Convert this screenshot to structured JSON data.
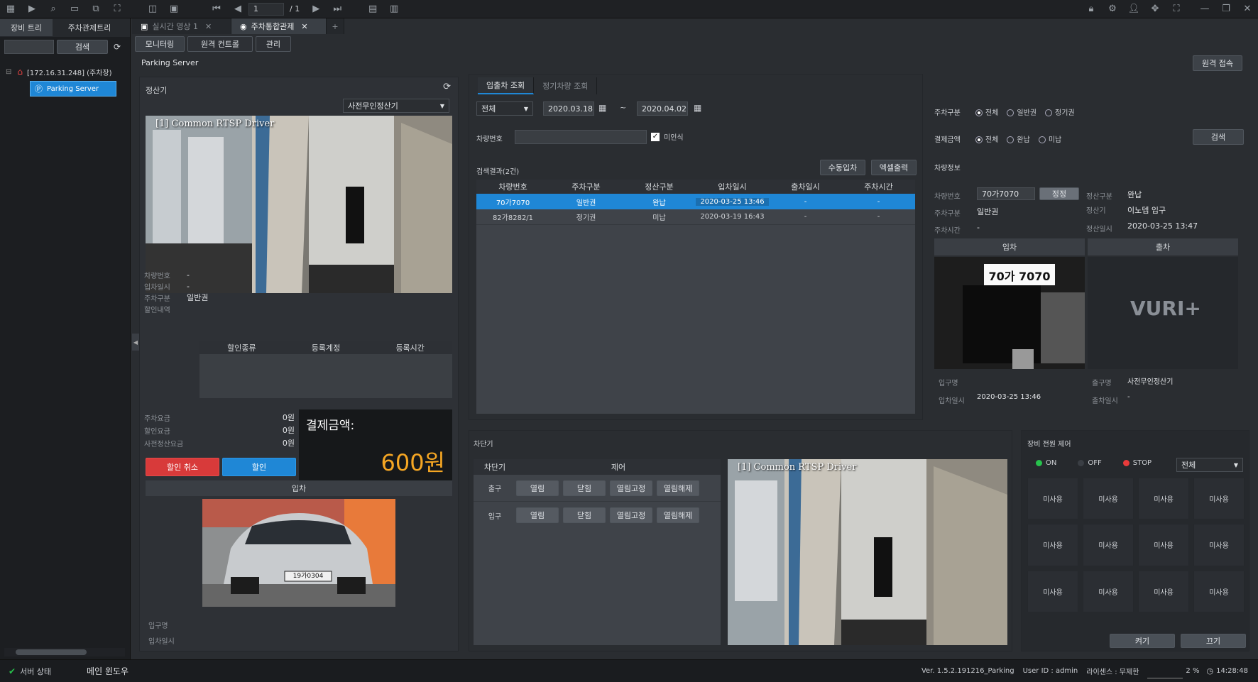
{
  "toolbar": {
    "page_current": "1",
    "page_total": "/ 1"
  },
  "left": {
    "tabs": [
      "장비 트리",
      "주차관제트리"
    ],
    "search_button": "검색",
    "tree_root": "[172.16.31.248] (주차장)",
    "tree_child": "Parking Server"
  },
  "doc_tabs": [
    {
      "label": "실시간 영상 1"
    },
    {
      "label": "주차통합관제"
    }
  ],
  "sub_tabs": [
    "모니터링",
    "원격 컨트롤",
    "관리"
  ],
  "server_label": "Parking Server",
  "remote_access_button": "원격 접속",
  "settlement": {
    "title": "정산기",
    "device_select": "사전무인정산기",
    "camera_overlay": "[1] Common RTSP Driver",
    "fields": {
      "car_number_label": "차량번호",
      "car_number_value": "-",
      "entry_time_label": "입차일시",
      "entry_time_value": "-",
      "parking_type_label": "주차구분",
      "parking_type_value": "일반권",
      "discount_label": "할인내역"
    },
    "discount_headers": [
      "할인종류",
      "등록계정",
      "등록시간"
    ],
    "fee_label": "주차요금",
    "fee_value": "0원",
    "discount_fee_label": "할인요금",
    "discount_fee_value": "0원",
    "prepaid_label": "사전정산요금",
    "prepaid_value": "0원",
    "pay_amount_label": "결제금액:",
    "pay_amount_value": "600원",
    "cancel_discount_button": "할인 취소",
    "discount_button": "할인",
    "entry_header": "입차",
    "plate_text": "19가0304",
    "entrance_label": "입구명",
    "entry_time2_label": "입차일시"
  },
  "search": {
    "tabs": [
      "입출차 조회",
      "정기차량 조회"
    ],
    "all_select": "전체",
    "date_from": "2020.03.18",
    "tilde": "~",
    "date_to": "2020.04.02",
    "car_number_label": "차량번호",
    "unrecognized_label": "미인식",
    "parking_type_label": "주차구분",
    "parking_type_options": [
      "전체",
      "일반권",
      "정기권"
    ],
    "payment_label": "결제금액",
    "payment_options": [
      "전체",
      "완납",
      "미납"
    ],
    "search_button": "검색",
    "result_title": "검색결과(2건)",
    "manual_entry_button": "수동입차",
    "excel_button": "엑셀출력",
    "columns": [
      "차량번호",
      "주차구분",
      "정산구분",
      "입차일시",
      "출차일시",
      "주차시간"
    ],
    "rows": [
      [
        "70가7070",
        "일반권",
        "완납",
        "2020-03-25 13:46",
        "-",
        "-"
      ],
      [
        "82가8282/1",
        "정기권",
        "미납",
        "2020-03-19 16:43",
        "-",
        "-"
      ]
    ]
  },
  "car_info": {
    "title": "차량정보",
    "car_number_label": "차량번호",
    "car_number_value": "70가7070",
    "edit_button": "정정",
    "settlement_type_label": "정산구분",
    "settlement_type_value": "완납",
    "parking_type_label": "주차구분",
    "parking_type_value": "일반권",
    "settler_label": "정산기",
    "settler_value": "이노뎁 입구",
    "parking_time_label": "주차시간",
    "parking_time_value": "-",
    "settle_time_label": "정산일시",
    "settle_time_value": "2020-03-25 13:47",
    "entry_header": "입차",
    "exit_header": "출차",
    "plate_text": "70가 7070",
    "logo_text": "VURI+",
    "entrance_label": "입구명",
    "entry_time_label": "입차일시",
    "entry_time_value": "2020-03-25 13:46",
    "exit_name_label": "출구명",
    "exit_name_value": "사전무인정산기",
    "exit_time_label": "출차일시",
    "exit_time_value": "-"
  },
  "barrier": {
    "title": "차단기",
    "col1": "차단기",
    "col2": "제어",
    "rows": [
      {
        "name": "출구",
        "buttons": [
          "열림",
          "닫힘",
          "열림고정",
          "열림해제"
        ]
      },
      {
        "name": "입구",
        "buttons": [
          "열림",
          "닫힘",
          "열림고정",
          "열림해제"
        ]
      }
    ],
    "camera_overlay": "[1] Common RTSP Driver"
  },
  "power": {
    "title": "장비 전원 제어",
    "on_label": "ON",
    "off_label": "OFF",
    "stop_label": "STOP",
    "select": "전체",
    "unused": "미사용",
    "on_button": "켜기",
    "off_button": "끄기"
  },
  "status": {
    "server_state": "서버 상태",
    "main_window": "메인 윈도우",
    "version": "Ver. 1.5.2.191216_Parking",
    "user": "User ID : admin",
    "license": "라이센스 : 무제한",
    "cpu": "2 %",
    "time": "14:28:48"
  },
  "colors": {
    "accent": "#1f87d6",
    "amount": "#f5a623",
    "danger": "#d83a3a",
    "on": "#27c24c",
    "stop": "#e83b3b"
  }
}
